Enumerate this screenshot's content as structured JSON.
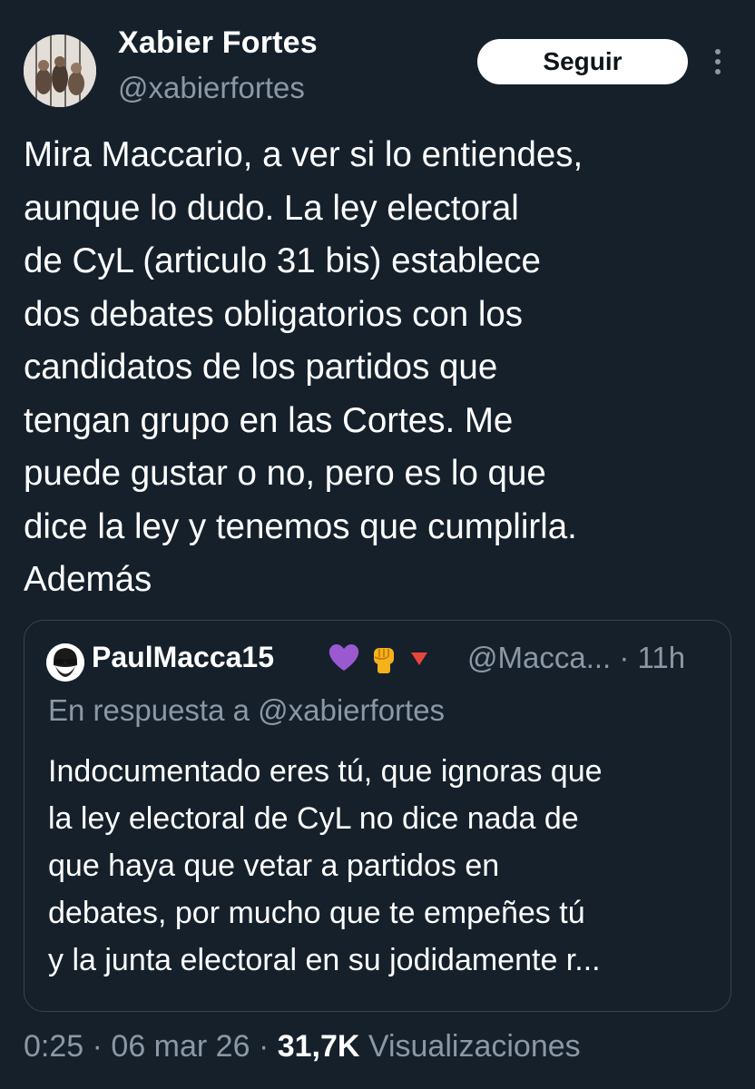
{
  "author": {
    "name": "Xabier Fortes",
    "handle": "@xabierfortes"
  },
  "follow_button": {
    "label": "Seguir"
  },
  "tweet": {
    "text": "Mira Maccario, a ver si lo entiendes,\naunque lo dudo. La ley electoral\nde CyL (articulo 31 bis) establece\ndos debates obligatorios con los\ncandidatos de los partidos que\ntengan grupo en las Cortes. Me\npuede gustar o no, pero es lo que\ndice la ley y tenemos que cumplirla.\nAdemás"
  },
  "quoted_tweet": {
    "name": "PaulMacca15",
    "emojis": [
      "purple-heart-icon",
      "raised-fist-icon",
      "red-triangle-icon"
    ],
    "handle_time": "@Macca... · 11h",
    "reply_to": "En respuesta a @xabierfortes",
    "text": "Indocumentado eres tú, que ignoras que\nla ley electoral de CyL no dice nada de\nque haya que vetar a partidos en\ndebates, por mucho que te empeñes tú\ny la junta electoral en su jodidamente r..."
  },
  "footer": {
    "time": "0:25",
    "separator": " · ",
    "date": "06 mar 26",
    "views_count": "31,7K",
    "views_label": "Visualizaciones"
  },
  "colors": {
    "background": "#15202b",
    "text_primary": "#ffffff",
    "text_secondary": "#8b98a5",
    "border": "#38444d",
    "follow_bg": "#ffffff"
  }
}
